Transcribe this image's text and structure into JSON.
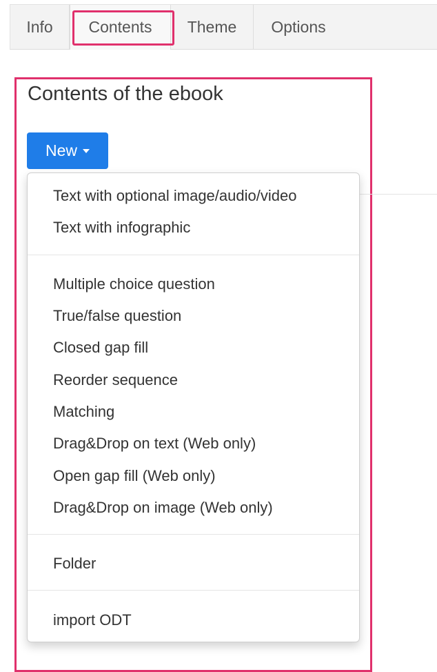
{
  "tabs": [
    {
      "label": "Info"
    },
    {
      "label": "Contents",
      "active": true
    },
    {
      "label": "Theme"
    },
    {
      "label": "Options"
    }
  ],
  "panel": {
    "title": "Contents of the ebook"
  },
  "new_button": {
    "label": "New"
  },
  "dropdown": {
    "groups": [
      [
        "Text with optional image/audio/video",
        "Text with infographic"
      ],
      [
        "Multiple choice question",
        "True/false question",
        "Closed gap fill",
        "Reorder sequence",
        "Matching",
        "Drag&Drop on text (Web only)",
        "Open gap fill (Web only)",
        "Drag&Drop on image (Web only)"
      ],
      [
        "Folder"
      ],
      [
        "import ODT"
      ]
    ]
  },
  "colors": {
    "highlight": "#e0306c",
    "primary_button": "#1f7de8"
  }
}
